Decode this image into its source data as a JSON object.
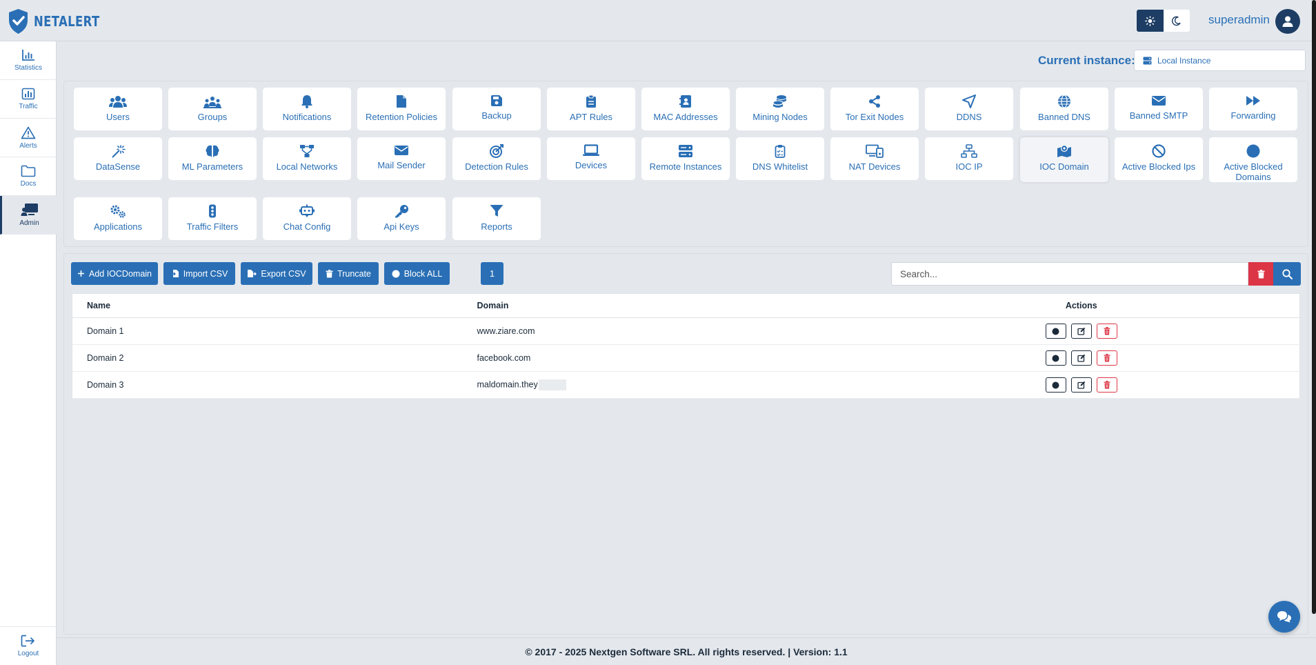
{
  "header": {
    "brand": "NETALERT",
    "user_name": "superadmin"
  },
  "sidebar": {
    "items": [
      {
        "label": "Statistics",
        "icon": "bar-chart-icon"
      },
      {
        "label": "Traffic",
        "icon": "traffic-chart-icon"
      },
      {
        "label": "Alerts",
        "icon": "warning-icon"
      },
      {
        "label": "Docs",
        "icon": "folder-icon"
      },
      {
        "label": "Admin",
        "icon": "admin-monitor-icon",
        "active": true
      }
    ],
    "logout": "Logout"
  },
  "instance": {
    "label": "Current instance:",
    "value": "Local Instance"
  },
  "tiles": [
    {
      "label": "Users",
      "icon": "users-icon"
    },
    {
      "label": "Groups",
      "icon": "groups-icon"
    },
    {
      "label": "Notifications",
      "icon": "bell-icon"
    },
    {
      "label": "Retention Policies",
      "icon": "file-icon"
    },
    {
      "label": "Backup",
      "icon": "save-icon"
    },
    {
      "label": "APT Rules",
      "icon": "clipboard-icon"
    },
    {
      "label": "MAC Addresses",
      "icon": "address-book-icon"
    },
    {
      "label": "Mining Nodes",
      "icon": "coins-icon"
    },
    {
      "label": "Tor Exit Nodes",
      "icon": "share-nodes-icon"
    },
    {
      "label": "DDNS",
      "icon": "location-arrow-icon"
    },
    {
      "label": "Banned DNS",
      "icon": "globe-icon"
    },
    {
      "label": "Banned SMTP",
      "icon": "envelope-icon"
    },
    {
      "label": "Forwarding",
      "icon": "fast-forward-icon"
    },
    {
      "label": "DataSense",
      "icon": "magic-wand-icon"
    },
    {
      "label": "ML Parameters",
      "icon": "brain-icon"
    },
    {
      "label": "Local Networks",
      "icon": "network-icon"
    },
    {
      "label": "Mail Sender",
      "icon": "envelope-icon"
    },
    {
      "label": "Detection Rules",
      "icon": "bullseye-icon"
    },
    {
      "label": "Devices",
      "icon": "laptop-icon"
    },
    {
      "label": "Remote Instances",
      "icon": "server-icon"
    },
    {
      "label": "DNS Whitelist",
      "icon": "clipboard-list-icon"
    },
    {
      "label": "NAT Devices",
      "icon": "devices-icon"
    },
    {
      "label": "IOC IP",
      "icon": "sitemap-icon"
    },
    {
      "label": "IOC Domain",
      "icon": "map-pin-icon",
      "active": true
    },
    {
      "label": "Active Blocked Ips",
      "icon": "ban-icon"
    },
    {
      "label": "Active Blocked Domains",
      "icon": "circle-icon"
    },
    {
      "label": "Applications",
      "icon": "cogs-icon"
    },
    {
      "label": "Traffic Filters",
      "icon": "traffic-light-icon"
    },
    {
      "label": "Chat Config",
      "icon": "robot-icon"
    },
    {
      "label": "Api Keys",
      "icon": "key-icon"
    },
    {
      "label": "Reports",
      "icon": "filter-icon"
    }
  ],
  "toolbar": {
    "add": "Add IOCDomain",
    "import": "Import CSV",
    "export": "Export CSV",
    "truncate": "Truncate",
    "block_all": "Block ALL",
    "page": "1",
    "search_placeholder": "Search..."
  },
  "table": {
    "headers": {
      "name": "Name",
      "domain": "Domain",
      "actions": "Actions"
    },
    "rows": [
      {
        "name": "Domain 1",
        "domain": "www.ziare.com"
      },
      {
        "name": "Domain 2",
        "domain": "facebook.com"
      },
      {
        "name": "Domain 3",
        "domain": "maldomain.they"
      }
    ]
  },
  "footer": {
    "text": "© 2017 - 2025 Nextgen Software SRL. All rights reserved. | Version: 1.1"
  },
  "colors": {
    "primary": "#2a6fb5",
    "dark": "#1d3d64",
    "danger": "#dc3545",
    "background": "#e4e8ed"
  }
}
